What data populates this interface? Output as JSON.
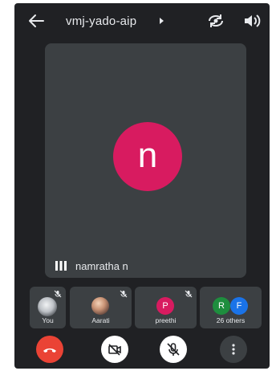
{
  "header": {
    "meeting_code": "vmj-yado-aip"
  },
  "main_tile": {
    "avatar_initial": "n",
    "avatar_color": "#d81b60",
    "speaker_name": "namratha n"
  },
  "participants": [
    {
      "label": "You",
      "muted": true
    },
    {
      "label": "Aarati",
      "muted": true
    },
    {
      "label": "preethi",
      "initial": "P",
      "color": "#d81b60",
      "muted": true
    },
    {
      "label": "26 others",
      "initials": [
        "R",
        "F"
      ],
      "colors": [
        "#1e8e3e",
        "#1a73e8"
      ]
    }
  ],
  "controls": {
    "end_call_color": "#ea4335"
  }
}
